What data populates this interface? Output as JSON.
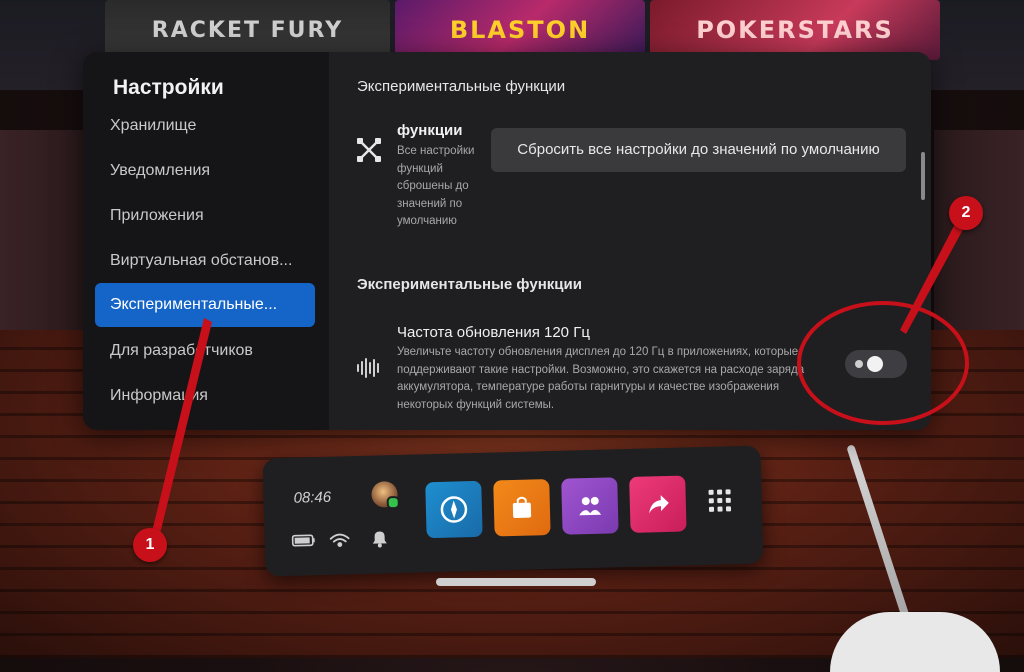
{
  "environment": {
    "posters": [
      "RACKET FURY",
      "BLASTON",
      "POKERSTARS"
    ]
  },
  "sidebar": {
    "title": "Настройки",
    "items": [
      {
        "label": "Хранилище",
        "active": false
      },
      {
        "label": "Уведомления",
        "active": false
      },
      {
        "label": "Приложения",
        "active": false
      },
      {
        "label": "Виртуальная обстанов...",
        "active": false
      },
      {
        "label": "Экспериментальные...",
        "active": true
      },
      {
        "label": "Для разработчиков",
        "active": false
      },
      {
        "label": "Информация",
        "active": false
      }
    ]
  },
  "content": {
    "section1_title": "Экспериментальные функции",
    "feature": {
      "icon": "cross-arrows-icon",
      "name": "функции",
      "description": "Все настройки функций сброшены до значений по умолчанию"
    },
    "reset_button": "Сбросить все настройки до значений по умолчанию",
    "section2_title": "Экспериментальные функции",
    "refresh_rate": {
      "icon": "sound-wave-icon",
      "name": "Частота обновления 120 Гц",
      "description": "Увеличьте частоту обновления дисплея до 120 Гц в приложениях, которые поддерживают такие настройки. Возможно, это скажется на расходе заряда аккумулятора, температуре работы гарнитуры и качестве изображения некоторых функций системы.",
      "toggle_on": false
    }
  },
  "taskbar": {
    "time": "08:46",
    "apps": [
      "explore-app-icon",
      "store-app-icon",
      "people-app-icon",
      "share-app-icon"
    ]
  },
  "annotations": {
    "badge1": "1",
    "badge2": "2",
    "color": "#c8101a"
  },
  "colors": {
    "accent": "#1565c8",
    "panel_bg": "#1f1f22"
  }
}
